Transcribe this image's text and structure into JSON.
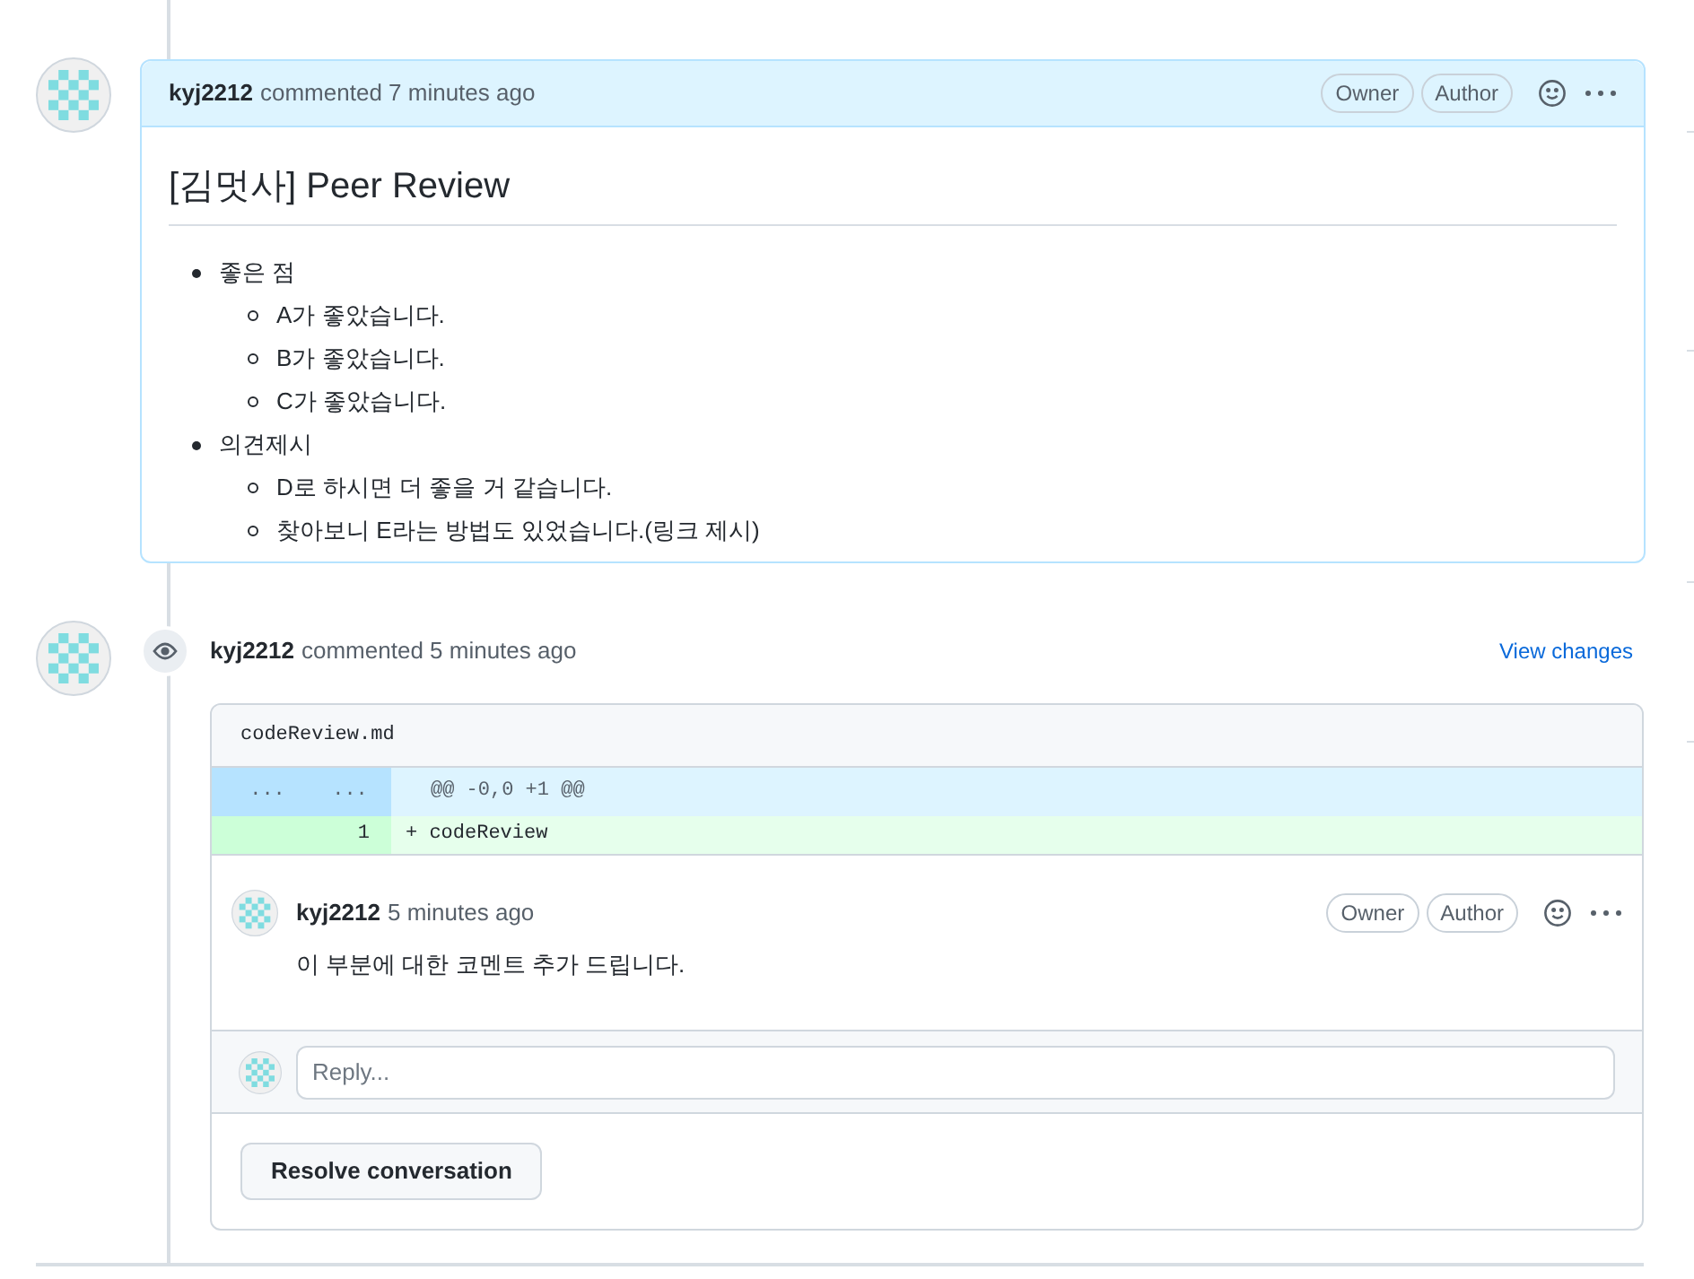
{
  "comment": {
    "author": "kyj2212",
    "meta": "commented 7 minutes ago",
    "badges": [
      "Owner",
      "Author"
    ],
    "heading": "[김멋사] Peer Review",
    "list": [
      {
        "text": "좋은 점",
        "children": [
          {
            "text": "A가 좋았습니다."
          },
          {
            "text": "B가 좋았습니다."
          },
          {
            "text": "C가 좋았습니다."
          }
        ]
      },
      {
        "text": "의견제시",
        "children": [
          {
            "text": "D로 하시면 더 좋을 거 같습니다."
          },
          {
            "text": "찾아보니 E라는 방법도 있었습니다.(링크 제시)"
          }
        ]
      }
    ]
  },
  "review": {
    "author": "kyj2212",
    "meta": "commented 5 minutes ago",
    "link": "View changes",
    "file": "codeReview.md",
    "hunk": {
      "old": "...",
      "new": "...",
      "text": "@@ -0,0 +1 @@"
    },
    "lines": [
      {
        "kind": "added",
        "new": "1",
        "text": "+ codeReview"
      }
    ],
    "reply": {
      "author": "kyj2212",
      "meta": "5 minutes ago",
      "badges": [
        "Owner",
        "Author"
      ],
      "body": "이 부분에 대한 코멘트 추가 드립니다."
    },
    "reply_field": {
      "placeholder": "Reply..."
    },
    "resolve": "Resolve conversation"
  }
}
